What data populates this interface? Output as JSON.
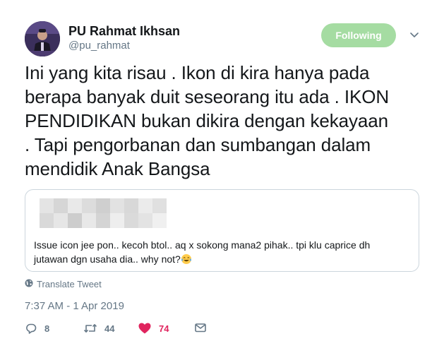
{
  "author": {
    "display_name": "PU Rahmat Ikhsan",
    "handle": "@pu_rahmat"
  },
  "follow_button": {
    "label": "Following",
    "color": "#a5dca2"
  },
  "tweet": {
    "lines": [
      "Ini yang kita risau . Ikon di kira hanya pada",
      "berapa banyak duit seseorang itu ada . IKON",
      "PENDIDIKAN bukan dikira dengan kekayaan",
      ". Tapi pengorbanan dan sumbangan dalam",
      "mendidik Anak Bangsa"
    ]
  },
  "quoted_tweet": {
    "author_redacted": true,
    "lines": [
      "Issue icon jee pon.. kecoh btol.. aq x sokong mana2 pihak.. tpi klu caprice dh",
      "jutawan dgn usaha dia.. why not?"
    ],
    "emoji": "face-with-tears-of-joy"
  },
  "translate_label": "Translate Tweet",
  "timestamp": "7:37 AM - 1 Apr 2019",
  "actions": {
    "reply_count": "8",
    "retweet_count": "44",
    "like_count": "74",
    "like_color": "#e0245e"
  },
  "icons": [
    "chevron-down-icon",
    "globe-icon",
    "reply-icon",
    "retweet-icon",
    "heart-icon",
    "mail-icon"
  ]
}
